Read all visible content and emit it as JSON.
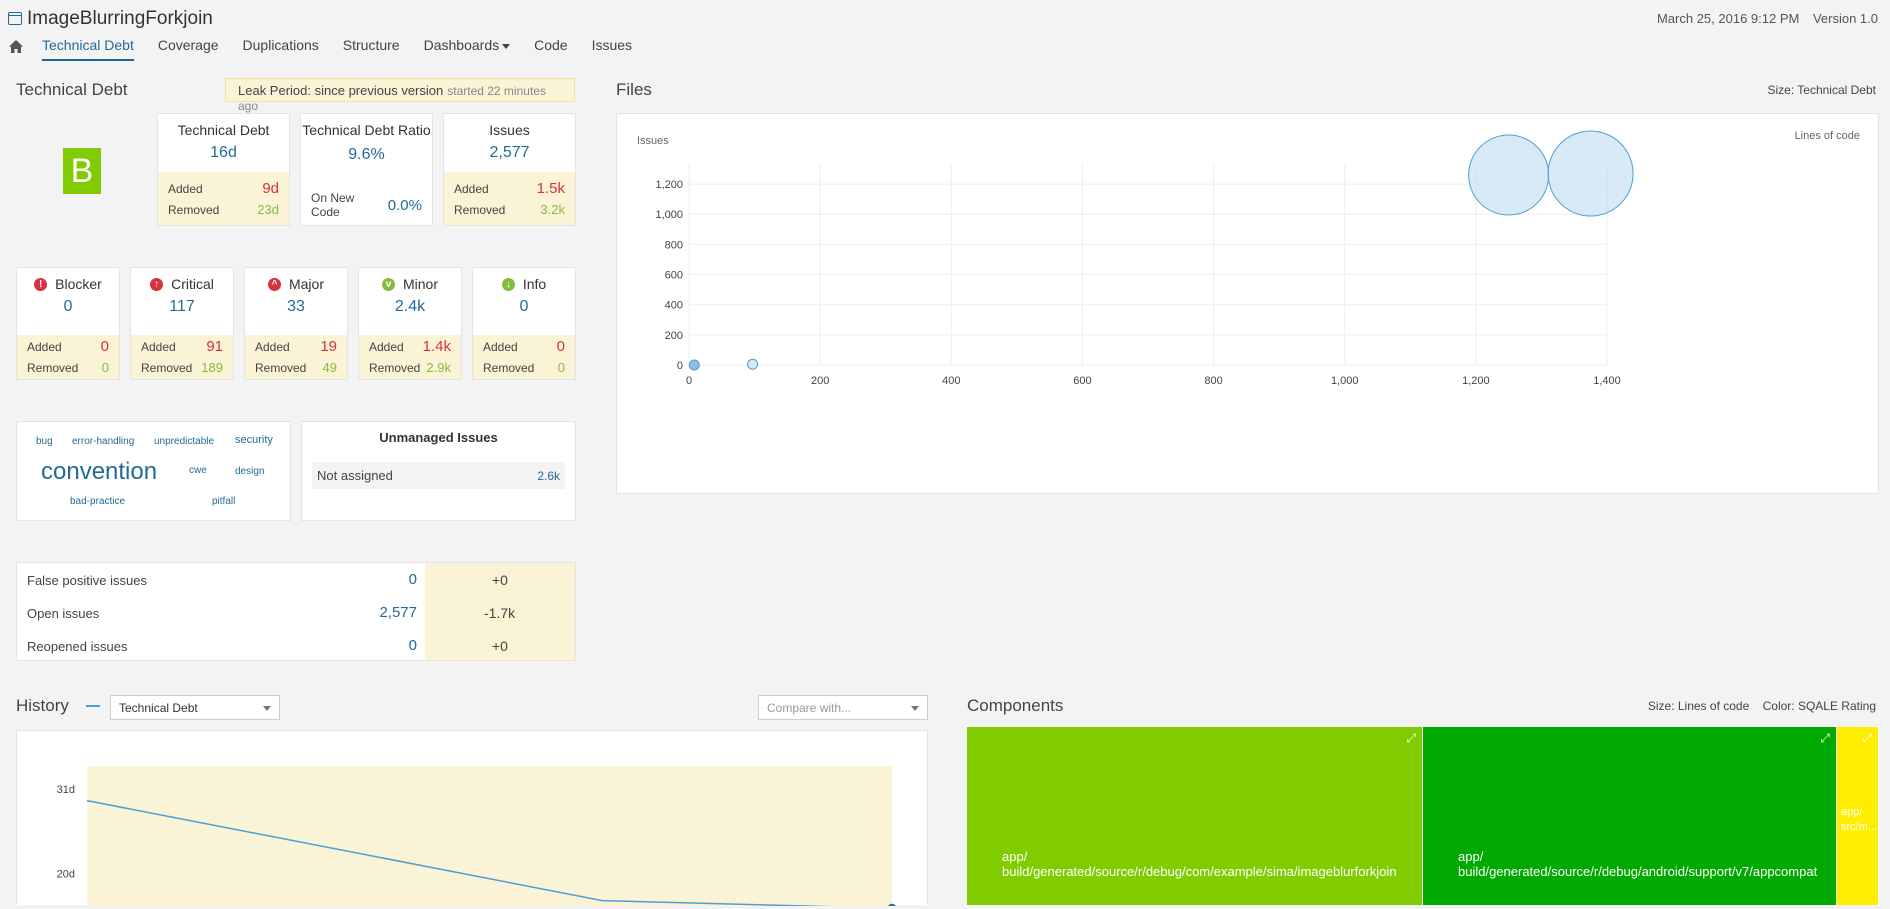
{
  "project": {
    "title": "ImageBlurringForkjoin",
    "date": "March 25, 2016 9:12 PM",
    "version": "Version 1.0"
  },
  "nav": {
    "items": [
      "Technical Debt",
      "Coverage",
      "Duplications",
      "Structure",
      "Dashboards",
      "Code",
      "Issues"
    ]
  },
  "debt": {
    "title": "Technical Debt",
    "leak_label": "Leak Period: since previous version",
    "leak_started": "started 22 minutes ago",
    "rating": "B",
    "cards": {
      "td": {
        "head": "Technical Debt",
        "value": "16d",
        "added_label": "Added",
        "added": "9d",
        "removed_label": "Removed",
        "removed": "23d"
      },
      "ratio": {
        "head": "Technical Debt Ratio",
        "value": "9.6%",
        "new_code_label": "On New Code",
        "new_code": "0.0%"
      },
      "issues": {
        "head": "Issues",
        "value": "2,577",
        "added_label": "Added",
        "added": "1.5k",
        "removed_label": "Removed",
        "removed": "3.2k"
      }
    }
  },
  "severities": [
    {
      "name": "Blocker",
      "value": "0",
      "added": "0",
      "removed": "0",
      "color": "#d4333f",
      "icon": "blocker-icon"
    },
    {
      "name": "Critical",
      "value": "117",
      "added": "91",
      "removed": "189",
      "color": "#d4333f",
      "icon": "critical-icon"
    },
    {
      "name": "Major",
      "value": "33",
      "added": "19",
      "removed": "49",
      "color": "#d4333f",
      "icon": "major-icon"
    },
    {
      "name": "Minor",
      "value": "2.4k",
      "added": "1.4k",
      "removed": "2.9k",
      "color": "#85bb43",
      "icon": "minor-icon"
    },
    {
      "name": "Info",
      "value": "0",
      "added": "0",
      "removed": "0",
      "color": "#85bb43",
      "icon": "info-icon"
    }
  ],
  "labels": {
    "added": "Added",
    "removed": "Removed"
  },
  "tags": [
    "bug",
    "error-handling",
    "unpredictable",
    "security",
    "convention",
    "cwe",
    "design",
    "bad-practice",
    "pitfall"
  ],
  "unmanaged": {
    "title": "Unmanaged Issues",
    "row_label": "Not assigned",
    "row_value": "2.6k"
  },
  "issue_status": [
    {
      "label": "False positive issues",
      "value": "0",
      "delta": "+0"
    },
    {
      "label": "Open issues",
      "value": "2,577",
      "delta": "-1.7k"
    },
    {
      "label": "Reopened issues",
      "value": "0",
      "delta": "+0"
    }
  ],
  "files": {
    "title": "Files",
    "size_label": "Size: Technical Debt",
    "chart_data": {
      "type": "scatter",
      "xlabel": "Lines of code",
      "ylabel": "Issues",
      "xlim": [
        0,
        1400
      ],
      "ylim": [
        0,
        1300
      ],
      "x_ticks": [
        "0",
        "200",
        "400",
        "600",
        "800",
        "1,000",
        "1,200",
        "1,400"
      ],
      "y_ticks": [
        "0",
        "200",
        "400",
        "600",
        "800",
        "1,000",
        "1,200"
      ],
      "points": [
        {
          "x": 8,
          "y": 0,
          "size": 1,
          "dark": true
        },
        {
          "x": 97,
          "y": 5,
          "size": 1,
          "dark": false
        },
        {
          "x": 1250,
          "y": 1260,
          "size": 8,
          "dark": false
        },
        {
          "x": 1375,
          "y": 1270,
          "size": 8.5,
          "dark": false
        }
      ],
      "grid": true
    }
  },
  "history": {
    "title": "History",
    "metric": "Technical Debt",
    "compare_placeholder": "Compare with...",
    "chart_data": {
      "type": "line",
      "y_ticks": [
        "31d",
        "20d"
      ],
      "series": [
        {
          "values": [
            29.5,
            16.5,
            15.5
          ]
        }
      ],
      "ylim": [
        8,
        34
      ]
    }
  },
  "components": {
    "title": "Components",
    "size_label": "Size: Lines of code",
    "color_label": "Color: SQALE Rating",
    "items": [
      {
        "label1": "app/",
        "label2": "build/generated/source/r/debug/com/example/sima/imageblurforkjoin",
        "share": 0.413,
        "color": "#80cc00"
      },
      {
        "label1": "app/",
        "label2": "build/generated/source/r/debug/android/support/v7/appcompat",
        "share": 0.375,
        "color": "#00aa00"
      },
      {
        "label1": "app/",
        "label2": "src/m...",
        "share": 0.038,
        "color": "#ffee00"
      }
    ]
  }
}
